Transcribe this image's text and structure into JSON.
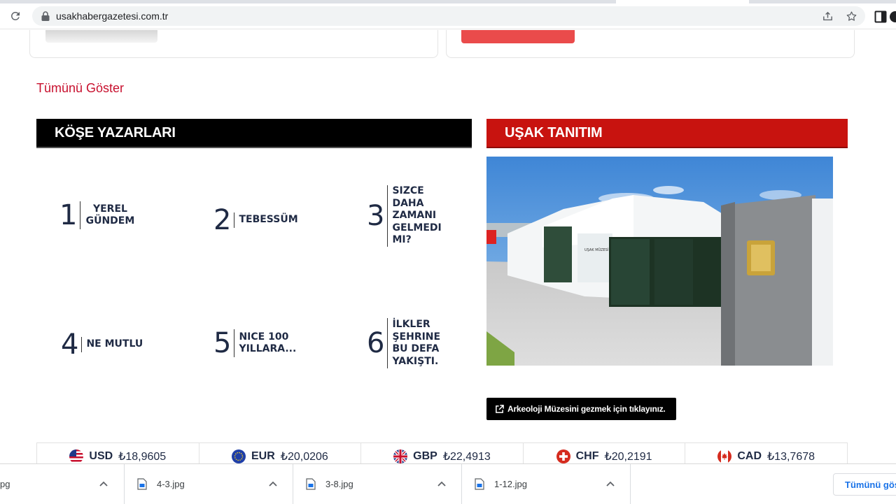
{
  "browser": {
    "url": "usakhabergazetesi.com.tr"
  },
  "page": {
    "show_all": "Tümünü Göster",
    "columnists": {
      "title": "KÖŞE YAZARLARI",
      "items": [
        {
          "num": "1",
          "title": "YEREL GÜNDEM"
        },
        {
          "num": "2",
          "title": "TEBESSÜM"
        },
        {
          "num": "3",
          "title": "SIZCE DAHA ZAMANI GELMEDI MI?"
        },
        {
          "num": "4",
          "title": "NE MUTLU"
        },
        {
          "num": "5",
          "title": "NICE 100 YILLARA..."
        },
        {
          "num": "6",
          "title": "İLKLER ŞEHRINE BU DEFA YAKIŞTI."
        }
      ]
    },
    "promo": {
      "title": "UŞAK TANITIM",
      "museum_sign": "UŞAK MÜZESİ",
      "button": "Arkeoloji Müzesini gezmek için tıklayınız."
    },
    "currencies": [
      {
        "code": "USD",
        "value": "₺18,9605",
        "flag": "us-flag-icon"
      },
      {
        "code": "EUR",
        "value": "₺20,0206",
        "flag": "eu-flag-icon"
      },
      {
        "code": "GBP",
        "value": "₺22,4913",
        "flag": "uk-flag-icon"
      },
      {
        "code": "CHF",
        "value": "₺20,2191",
        "flag": "ch-flag-icon"
      },
      {
        "code": "CAD",
        "value": "₺13,7678",
        "flag": "ca-flag-icon"
      }
    ]
  },
  "downloads": {
    "items": [
      {
        "name": "pg"
      },
      {
        "name": "4-3.jpg"
      },
      {
        "name": "3-8.jpg"
      },
      {
        "name": "1-12.jpg"
      }
    ],
    "show_all": "Tümünü göst"
  }
}
